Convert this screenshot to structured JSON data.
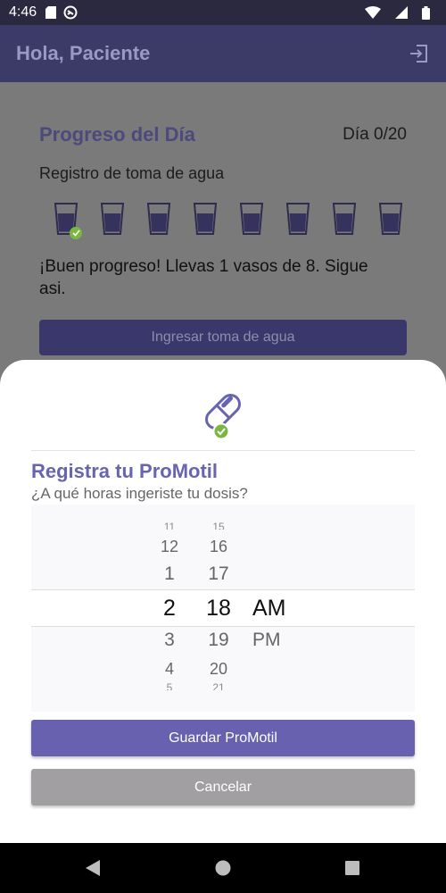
{
  "status_bar": {
    "time": "4:46",
    "icons": [
      "sd-card-icon",
      "sync-icon",
      "wifi-icon",
      "signal-icon",
      "battery-icon"
    ]
  },
  "app_bar": {
    "title": "Hola, Paciente",
    "logout_icon": "logout-icon"
  },
  "background": {
    "progress_title": "Progreso del Día",
    "day_label": "Día 0/20",
    "water_label": "Registro de toma de agua",
    "glasses_total": 8,
    "glasses_done": 1,
    "progress_message": "¡Buen progreso! Llevas 1 vasos de 8. Sigue asi.",
    "water_button": "Ingresar toma de agua"
  },
  "sheet": {
    "icon": "pill-check-icon",
    "title": "Registra tu ProMotil",
    "question": "¿A qué horas ingeriste tu dosis?",
    "picker": {
      "hours": [
        "11",
        "12",
        "1",
        "2",
        "3",
        "4",
        "5"
      ],
      "minutes": [
        "15",
        "16",
        "17",
        "18",
        "19",
        "20",
        "21"
      ],
      "period": [
        "AM",
        "PM"
      ],
      "selected": {
        "hour": "2",
        "minute": "18",
        "period": "AM"
      }
    },
    "save_button": "Guardar ProMotil",
    "cancel_button": "Cancelar"
  },
  "colors": {
    "primary": "#6761b0",
    "app_bar": "#3c3a66",
    "accent_green": "#7ab640",
    "cancel": "#a19fa2"
  },
  "nav_bar": {
    "icons": [
      "back-icon",
      "home-icon",
      "recents-icon"
    ]
  }
}
